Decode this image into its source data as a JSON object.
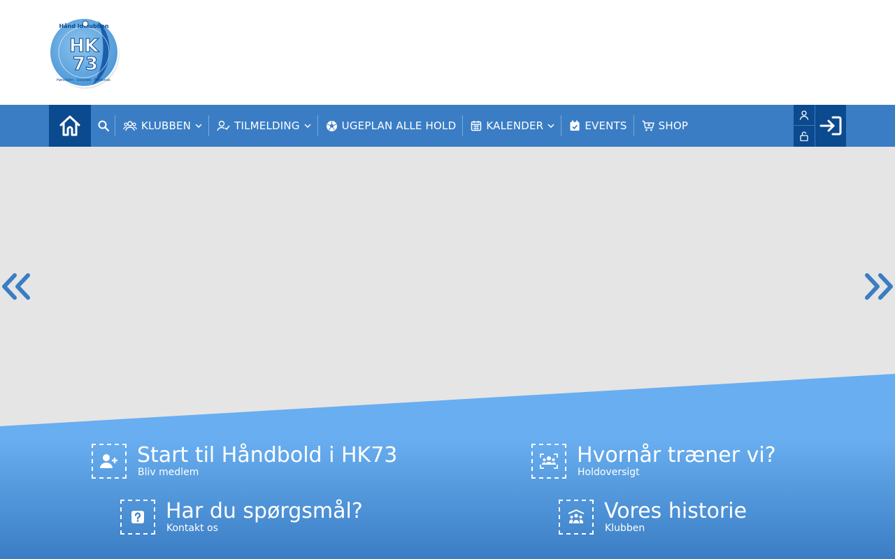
{
  "header": {
    "logo": {
      "text_top": "Håndboldklubben",
      "text_main": "HK73",
      "text_bottom": "Hørsholm · Usserød · Fredensborg"
    }
  },
  "nav": {
    "home_icon": "home-icon",
    "search_icon": "search-icon",
    "items": [
      {
        "label": "KLUBBEN",
        "icon": "users-icon",
        "dropdown": true
      },
      {
        "label": "TILMELDING",
        "icon": "user-check-icon",
        "dropdown": true
      },
      {
        "label": "UGEPLAN ALLE HOLD",
        "icon": "football-icon",
        "dropdown": false
      },
      {
        "label": "KALENDER",
        "icon": "calendar-icon",
        "dropdown": true
      },
      {
        "label": "EVENTS",
        "icon": "calendar-check-icon",
        "dropdown": false
      },
      {
        "label": "SHOP",
        "icon": "cart-icon",
        "dropdown": false
      }
    ],
    "user_icon": "user-icon",
    "unlock_icon": "unlock-icon",
    "login_icon": "sign-in-icon"
  },
  "slider": {
    "prev_icon": "double-chevron-left-icon",
    "next_icon": "double-chevron-right-icon"
  },
  "cards": [
    {
      "title": "Start til Håndbold i HK73",
      "subtitle": "Bliv medlem",
      "icon": "user-plus-icon"
    },
    {
      "title": "Hvornår træner vi?",
      "subtitle": "Holdoversigt",
      "icon": "team-scan-icon"
    },
    {
      "title": "Har du spørgsmål?",
      "subtitle": "Kontakt os",
      "icon": "question-icon"
    },
    {
      "title": "Vores historie",
      "subtitle": "Klubben",
      "icon": "team-icon"
    }
  ],
  "colors": {
    "nav": "#3a7dc4",
    "nav_dark": "#0b4a8f",
    "band_top": "#69aef0",
    "band_bottom": "#3a7dc4",
    "slider_bg": "#e5e5e5"
  }
}
